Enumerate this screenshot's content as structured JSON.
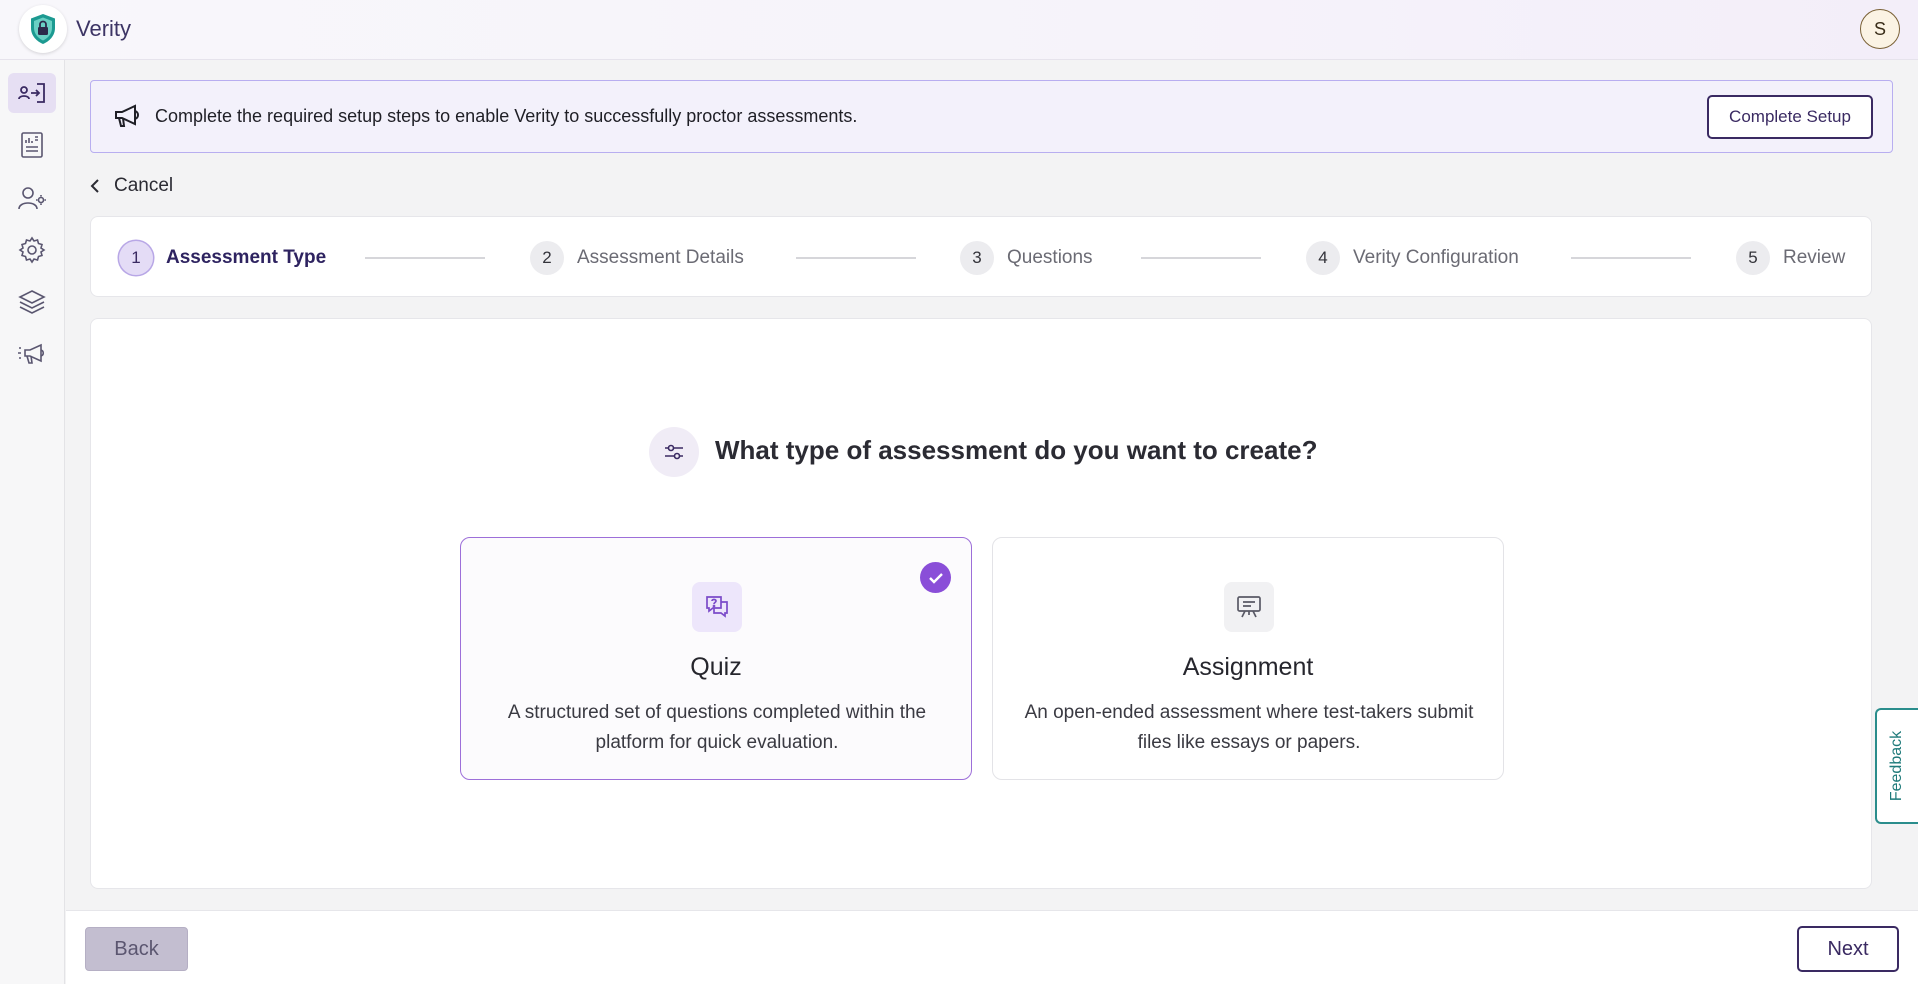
{
  "app": {
    "title": "Verity",
    "avatar_initial": "S"
  },
  "sidebar": {
    "items": [
      {
        "icon": "user-switch-icon",
        "active": true
      },
      {
        "icon": "report-icon",
        "active": false
      },
      {
        "icon": "user-settings-icon",
        "active": false
      },
      {
        "icon": "gear-icon",
        "active": false
      },
      {
        "icon": "layers-icon",
        "active": false
      },
      {
        "icon": "megaphone-icon",
        "active": false
      }
    ]
  },
  "banner": {
    "text": "Complete the required setup steps to enable Verity to successfully proctor assessments.",
    "button_label": "Complete Setup"
  },
  "nav": {
    "cancel_label": "Cancel"
  },
  "stepper": {
    "steps": [
      {
        "number": "1",
        "label": "Assessment Type",
        "active": true
      },
      {
        "number": "2",
        "label": "Assessment Details",
        "active": false
      },
      {
        "number": "3",
        "label": "Questions",
        "active": false
      },
      {
        "number": "4",
        "label": "Verity Configuration",
        "active": false
      },
      {
        "number": "5",
        "label": "Review",
        "active": false
      }
    ]
  },
  "main": {
    "question": "What type of assessment do you want to create?",
    "options": [
      {
        "title": "Quiz",
        "description": "A structured set of questions completed within the platform for quick evaluation.",
        "selected": true,
        "icon": "chat-question-icon"
      },
      {
        "title": "Assignment",
        "description": "An open-ended assessment where test-takers submit files like essays or papers.",
        "selected": false,
        "icon": "presentation-board-icon"
      }
    ]
  },
  "footer": {
    "back_label": "Back",
    "next_label": "Next"
  },
  "feedback": {
    "label": "Feedback"
  },
  "colors": {
    "accent": "#8a4ed8",
    "primary_dark": "#3a2a62",
    "feedback": "#2a8d8c"
  }
}
